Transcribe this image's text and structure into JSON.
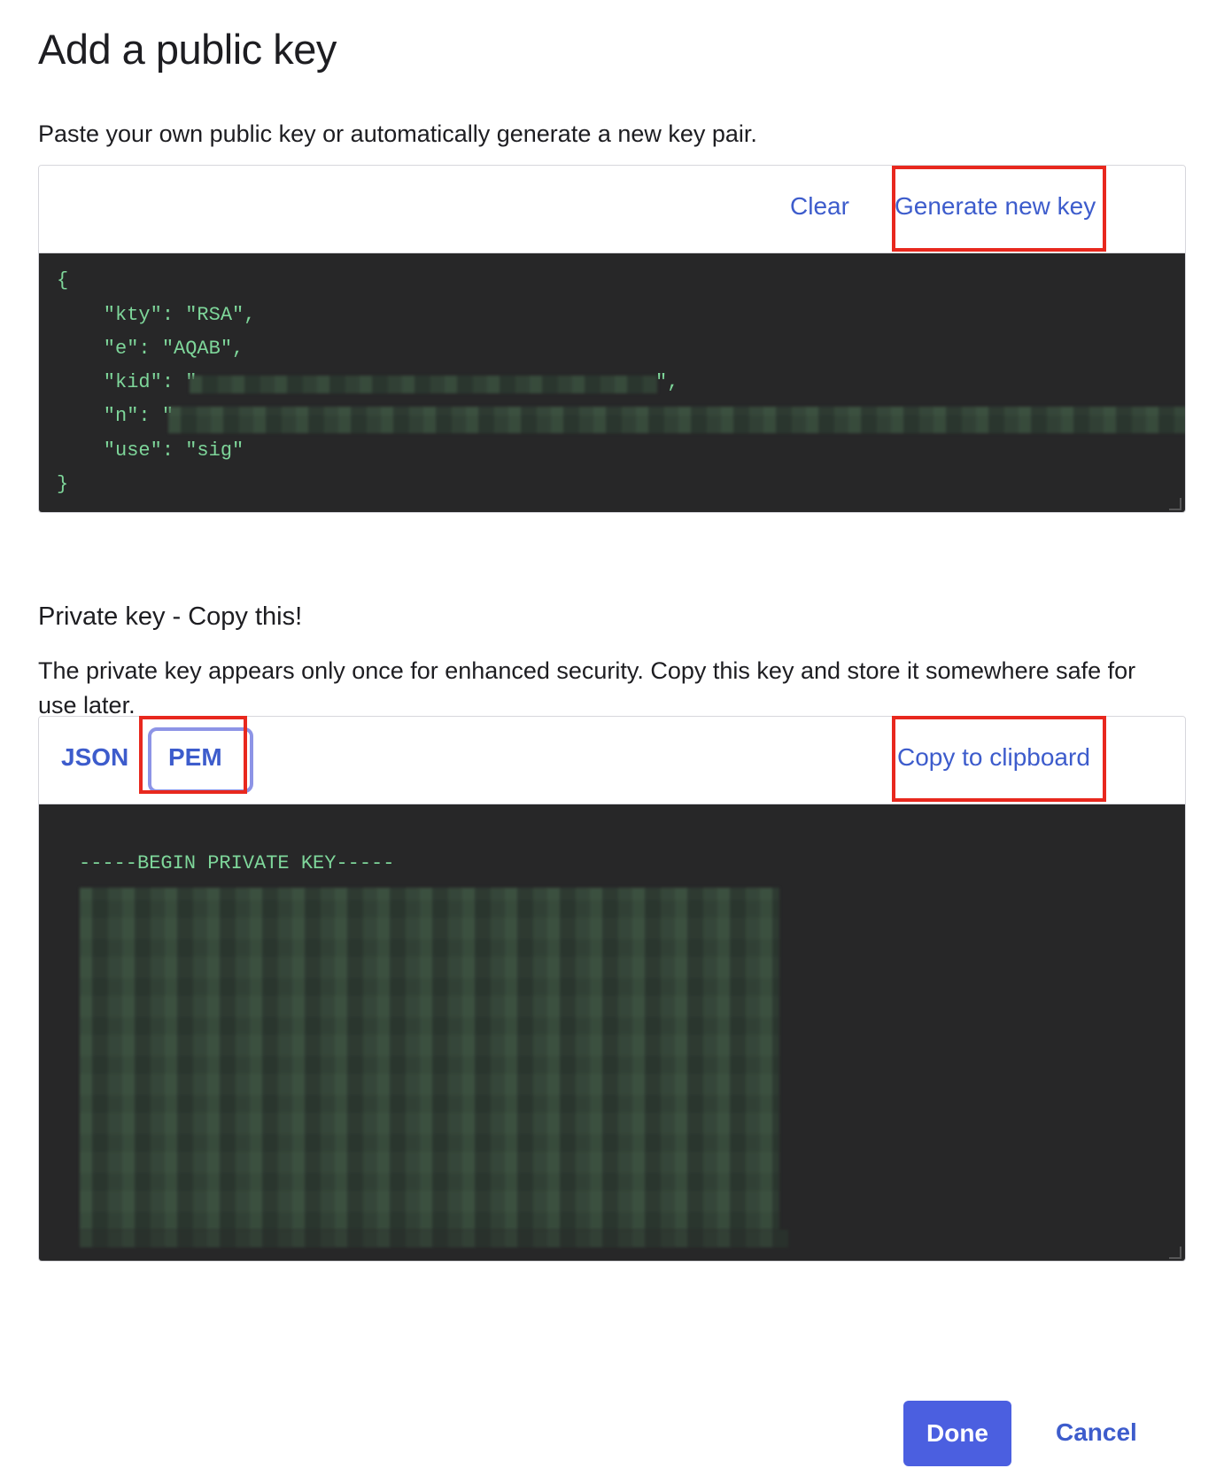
{
  "title": "Add a public key",
  "intro": "Paste your own public key or automatically generate a new key pair.",
  "public_key": {
    "clear_label": "Clear",
    "generate_label": "Generate new key",
    "lines": [
      "{",
      "    \"kty\": \"RSA\",",
      "    \"e\": \"AQAB\",",
      "    \"kid\": \"",
      "    \"n\": \"",
      "    \"use\": \"sig\"",
      "}"
    ],
    "kid_suffix": "\","
  },
  "private_key": {
    "heading": "Private key - Copy this!",
    "description": "The private key appears only once for enhanced security. Copy this key and store it somewhere safe for use later.",
    "tabs": [
      "JSON",
      "PEM"
    ],
    "active_tab": "PEM",
    "copy_label": "Copy to clipboard",
    "begin_line": "-----BEGIN PRIVATE KEY-----"
  },
  "footer": {
    "done_label": "Done",
    "cancel_label": "Cancel"
  },
  "colors": {
    "accent": "#3d5ccc",
    "primary_button": "#4b5fe0",
    "code_background": "#272728",
    "code_text": "#7ed69a",
    "highlight_box": "#e8281e"
  }
}
